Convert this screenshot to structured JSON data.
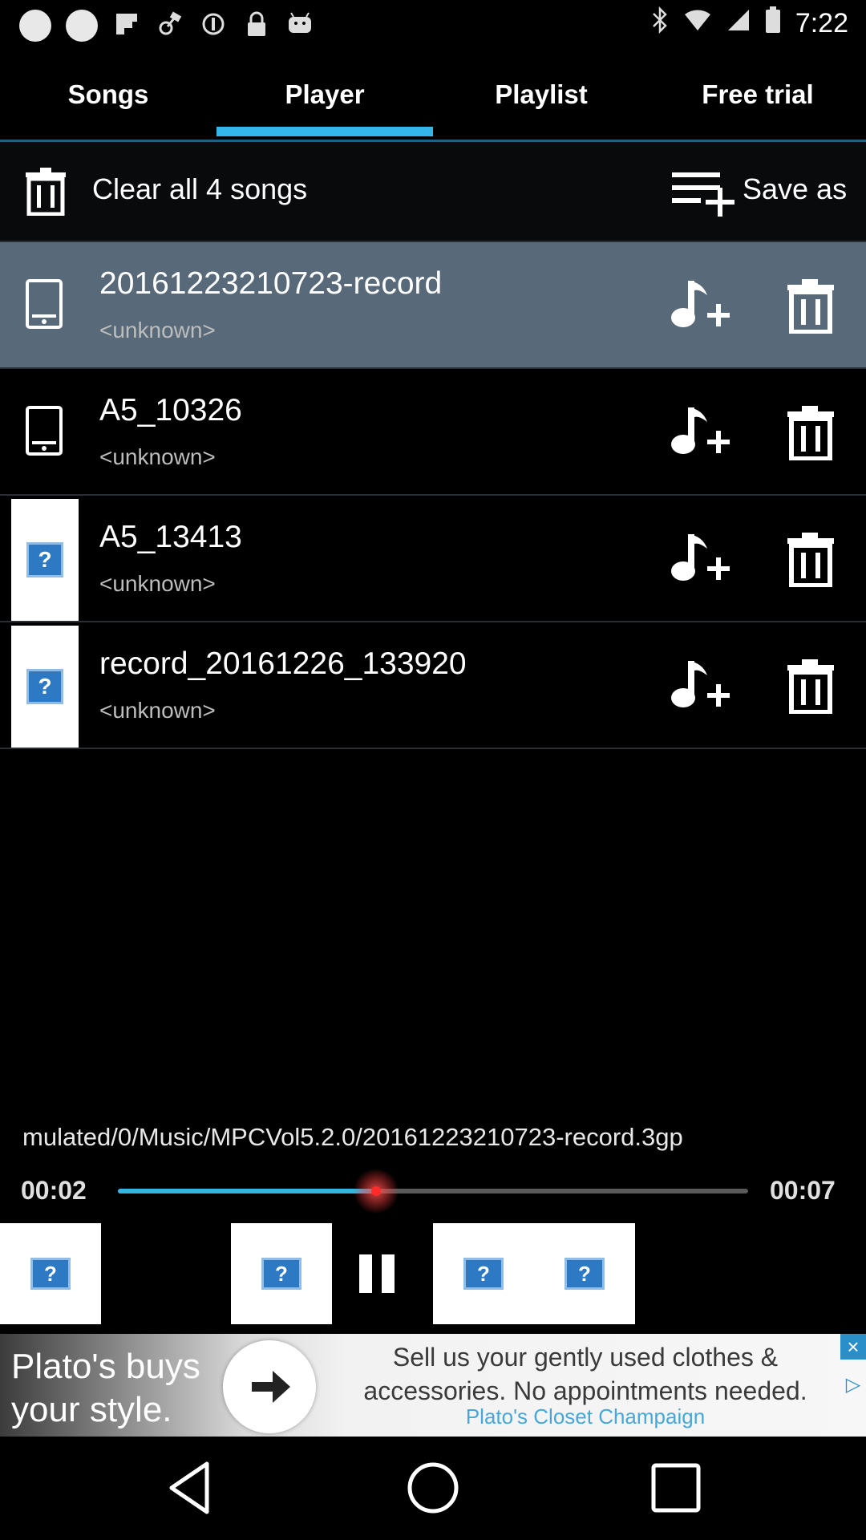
{
  "status_bar": {
    "time": "7:22",
    "left_icons": [
      "notification-dot",
      "notification-dot",
      "flipboard-icon",
      "fake-gps-icon",
      "circle-icon",
      "lock-icon",
      "android-icon"
    ],
    "right_icons": [
      "bluetooth-icon",
      "wifi-icon",
      "signal-icon",
      "battery-icon"
    ]
  },
  "tabs": [
    {
      "label": "Songs",
      "selected": false
    },
    {
      "label": "Player",
      "selected": true
    },
    {
      "label": "Playlist",
      "selected": false
    },
    {
      "label": "Free trial",
      "selected": false
    }
  ],
  "toolbar": {
    "clear_label": "Clear all 4 songs",
    "save_label": "Save as"
  },
  "songs": [
    {
      "title": "20161223210723-record",
      "artist": "<unknown>",
      "thumb": "phone",
      "active": true
    },
    {
      "title": "A5_10326",
      "artist": "<unknown>",
      "thumb": "phone",
      "active": false
    },
    {
      "title": "A5_13413",
      "artist": "<unknown>",
      "thumb": "unknown",
      "active": false
    },
    {
      "title": "record_20161226_133920",
      "artist": "<unknown>",
      "thumb": "unknown",
      "active": false
    }
  ],
  "player": {
    "file_path": "mulated/0/Music/MPCVol5.2.0/20161223210723-record.3gp",
    "elapsed": "00:02",
    "duration": "00:07",
    "progress_fraction": 0.41
  },
  "ad": {
    "left_text": "Plato's buys your style.",
    "main_text": "Sell us your gently used clothes & accessories. No appointments needed.",
    "sub_text": "Plato's Closet Champaign"
  },
  "colors": {
    "accent": "#34b7e8",
    "active_row": "#586a79",
    "knob": "#ff2a2a"
  }
}
